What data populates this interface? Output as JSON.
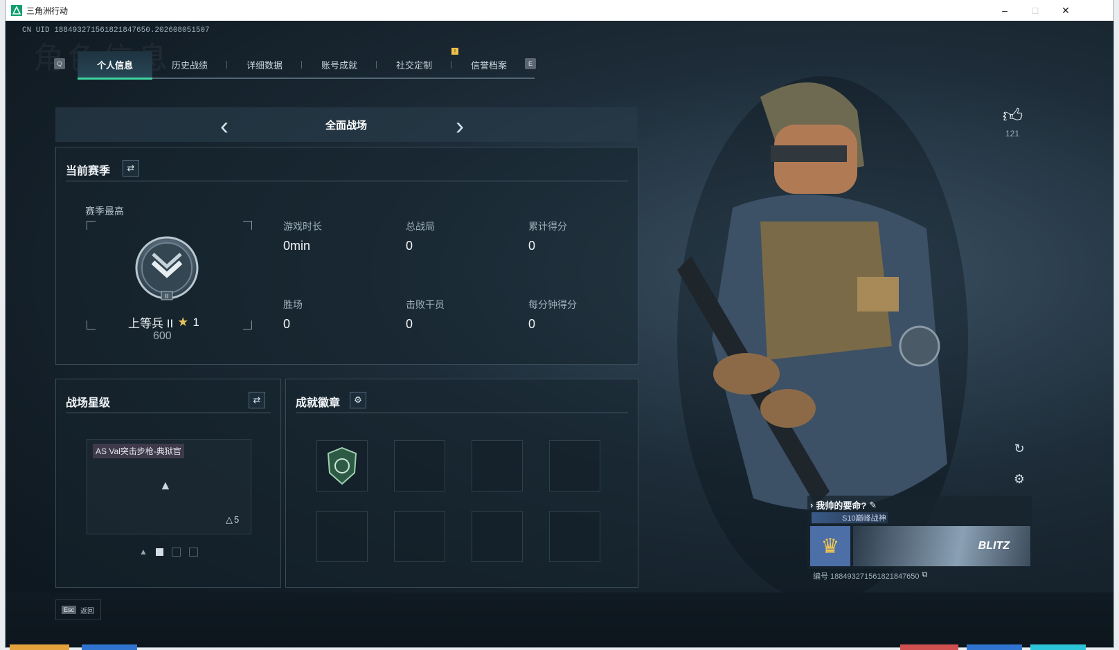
{
  "window": {
    "title": "三角洲行动"
  },
  "uid": "CN UID 188493271561821847650.202608051507",
  "bg_title": "角色信息",
  "tabs": [
    {
      "label": "个人信息",
      "active": true
    },
    {
      "label": "历史战绩"
    },
    {
      "label": "详细数据"
    },
    {
      "label": "账号成就"
    },
    {
      "label": "社交定制"
    },
    {
      "label": "信誉档案"
    }
  ],
  "tab_keys": {
    "left": "Q",
    "right": "E"
  },
  "mode": {
    "name": "全面战场"
  },
  "season": {
    "title": "当前赛季",
    "best_label": "赛季最高",
    "rank_name": "上等兵 II",
    "rank_stars": "1",
    "rank_points": "600",
    "stats": [
      {
        "label": "游戏时长",
        "value": "0min"
      },
      {
        "label": "总战局",
        "value": "0"
      },
      {
        "label": "累计得分",
        "value": "0"
      },
      {
        "label": "胜场",
        "value": "0"
      },
      {
        "label": "击败干员",
        "value": "0"
      },
      {
        "label": "每分钟得分",
        "value": "0"
      }
    ]
  },
  "battlefield_star": {
    "title": "战场星级",
    "weapon_name": "AS Val突击步枪-典狱官",
    "star_level": "5"
  },
  "badges": {
    "title": "成就徽章",
    "slots": 8
  },
  "likes": {
    "count": "121"
  },
  "profile": {
    "name": "我帅的要命?",
    "title_badge": "S10巅峰战神",
    "banner_text": "BLITZ",
    "id_label": "编号 188493271561821847650"
  },
  "footer": {
    "esc_key": "Esc",
    "back_label": "返回"
  },
  "colors": {
    "accent": "#3fd7a0",
    "tab_active_bg": "#274656",
    "notify": "#f2c14a"
  }
}
